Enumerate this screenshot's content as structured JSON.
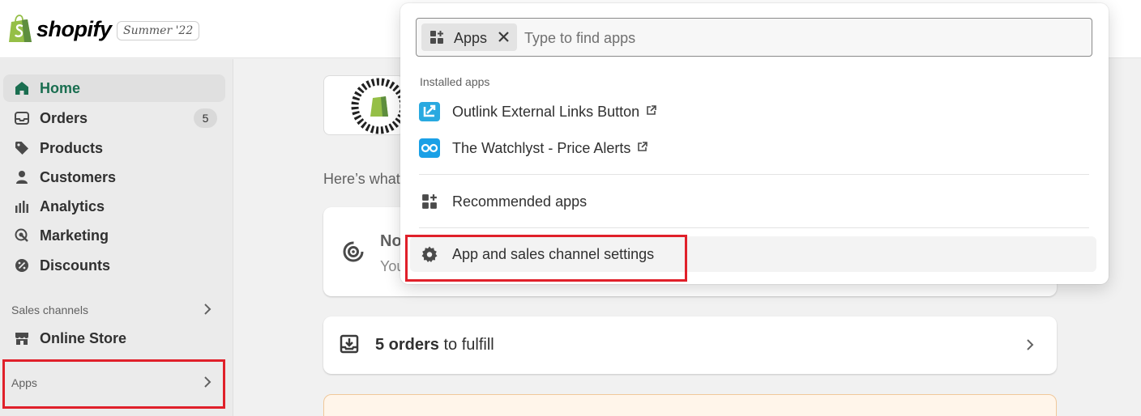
{
  "brand": {
    "wordmark": "shopify",
    "edition": "Summer '22",
    "logo_color": "#95bf47"
  },
  "sidebar": {
    "items": [
      {
        "label": "Home",
        "icon": "home-icon",
        "active": true
      },
      {
        "label": "Orders",
        "icon": "orders-inbox-icon",
        "badge": "5"
      },
      {
        "label": "Products",
        "icon": "tag-icon"
      },
      {
        "label": "Customers",
        "icon": "person-icon"
      },
      {
        "label": "Analytics",
        "icon": "bar-chart-icon"
      },
      {
        "label": "Marketing",
        "icon": "target-icon"
      },
      {
        "label": "Discounts",
        "icon": "discount-icon"
      }
    ],
    "sales_channels_label": "Sales channels",
    "online_store_label": "Online Store",
    "apps_label": "Apps"
  },
  "main": {
    "intro_text": "Here’s what’",
    "card1_heading": "No",
    "card1_sub": "You",
    "fulfill_bold": "5 orders",
    "fulfill_rest": " to fulfill",
    "edition_badge_text": "SHOPIFY EDITIONS"
  },
  "dropdown": {
    "chip_label": "Apps",
    "search_placeholder": "Type to find apps",
    "installed_label": "Installed apps",
    "installed_apps": [
      {
        "label": "Outlink External Links Button",
        "icon": "outlink-app-icon",
        "icon_color": "#29a9e0"
      },
      {
        "label": "The Watchlyst - Price Alerts",
        "icon": "watchlyst-app-icon",
        "icon_color": "#1aa0e6"
      }
    ],
    "recommended_label": "Recommended apps",
    "settings_label": "App and sales channel settings"
  },
  "colors": {
    "active_nav": "#1a6e50",
    "highlight": "#e0202a"
  }
}
